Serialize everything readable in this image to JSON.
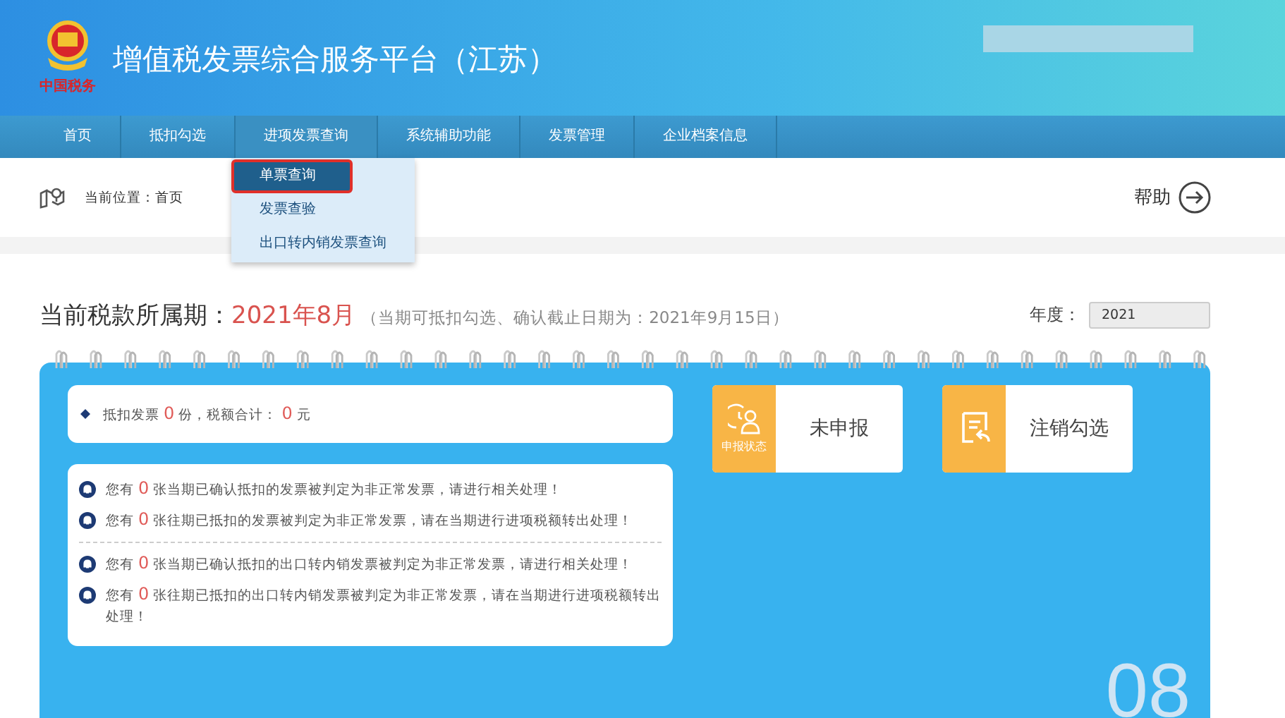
{
  "header": {
    "logo_text": "中国税务",
    "title": "增值税发票综合服务平台（江苏）"
  },
  "nav": [
    {
      "label": "首页",
      "expanded": false
    },
    {
      "label": "抵扣勾选",
      "expanded": false
    },
    {
      "label": "进项发票查询",
      "expanded": true,
      "menu": [
        {
          "label": "单票查询",
          "selected": true
        },
        {
          "label": "发票查验",
          "selected": false
        },
        {
          "label": "出口转内销发票查询",
          "selected": false
        }
      ]
    },
    {
      "label": "系统辅助功能",
      "expanded": false
    },
    {
      "label": "发票管理",
      "expanded": false
    },
    {
      "label": "企业档案信息",
      "expanded": false
    }
  ],
  "breadcrumb": "当前位置：首页",
  "help": "帮助",
  "period": {
    "label": "当前税款所属期：",
    "value": "2021年8月",
    "note": "（当期可抵扣勾选、确认截止日期为：2021年9月15日）"
  },
  "year": {
    "label": "年度：",
    "value": "2021"
  },
  "summary": [
    {
      "kind": "text",
      "text": "抵扣发票 "
    },
    {
      "kind": "count",
      "text": "0"
    },
    {
      "kind": "text",
      "text": " 份，税额合计： "
    },
    {
      "kind": "count",
      "text": "0"
    },
    {
      "kind": "text",
      "text": " 元"
    }
  ],
  "notice_groups": [
    {
      "items": [
        [
          {
            "kind": "text",
            "text": "您有 "
          },
          {
            "kind": "count",
            "text": "0"
          },
          {
            "kind": "text",
            "text": " 张当期已确认抵扣的发票被判定为非正常发票，请进行相关处理！"
          }
        ],
        [
          {
            "kind": "text",
            "text": "您有 "
          },
          {
            "kind": "count",
            "text": "0"
          },
          {
            "kind": "text",
            "text": " 张往期已抵扣的发票被判定为非正常发票，请在当期进行进项税额转出处理！"
          }
        ]
      ]
    },
    {
      "items": [
        [
          {
            "kind": "text",
            "text": "您有 "
          },
          {
            "kind": "count",
            "text": "0"
          },
          {
            "kind": "text",
            "text": " 张当期已确认抵扣的出口转内销发票被判定为非正常发票，请进行相关处理！"
          }
        ],
        [
          {
            "kind": "text",
            "text": "您有 "
          },
          {
            "kind": "count",
            "text": "0"
          },
          {
            "kind": "text",
            "text": " 张往期已抵扣的出口转内销发票被判定为非正常发票，请在当期进行进项税额转出处理！"
          }
        ]
      ]
    }
  ],
  "tiles": [
    {
      "kind": "status",
      "caption": "申报状态",
      "label": "未申报"
    },
    {
      "kind": "cancel",
      "label": "注销勾选"
    }
  ],
  "month_badge": "08"
}
